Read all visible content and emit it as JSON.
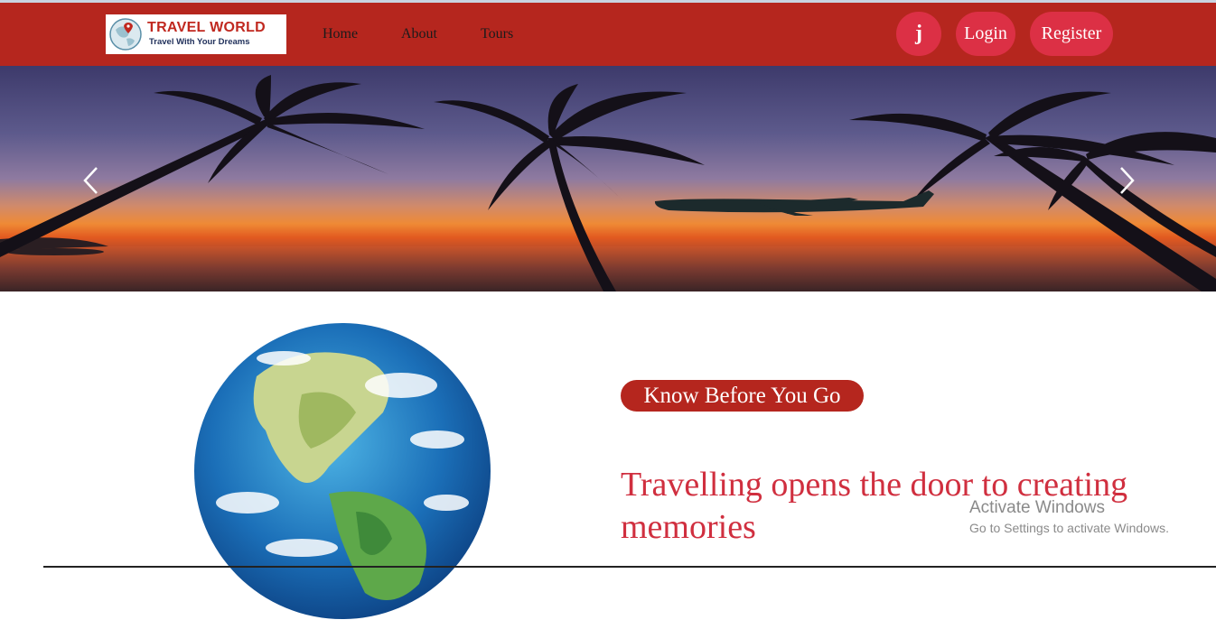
{
  "header": {
    "logo_title": "TRAVEL WORLD",
    "logo_subtitle": "Travel With Your Dreams",
    "nav": [
      "Home",
      "About",
      "Tours"
    ],
    "user_initial": "j",
    "login_label": "Login",
    "register_label": "Register"
  },
  "colors": {
    "header_bg": "#b5261e",
    "pill_bg": "#dc3045",
    "heading": "#d02f3f"
  },
  "hero": {
    "prev_icon": "chevron-left-icon",
    "next_icon": "chevron-right-icon"
  },
  "main": {
    "badge": "Know Before You Go",
    "heading": "Travelling opens the door to creating memories"
  },
  "watermark": {
    "title": "Activate Windows",
    "subtitle": "Go to Settings to activate Windows."
  }
}
